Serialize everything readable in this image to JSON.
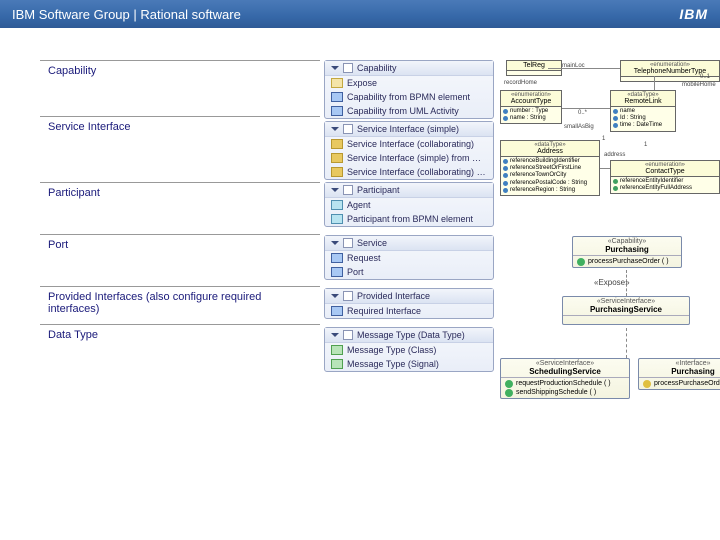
{
  "header": {
    "title": "IBM Software Group | Rational software",
    "logo_text": "IBM"
  },
  "sections": [
    {
      "title": "Capability"
    },
    {
      "title": "Service Interface"
    },
    {
      "title": "Participant"
    },
    {
      "title": "Port"
    },
    {
      "title": "Provided Interfaces (also configure required interfaces)"
    },
    {
      "title": "Data Type"
    }
  ],
  "menus": {
    "capability": {
      "header": "Capability",
      "items": [
        {
          "label": "Expose",
          "icon": "yellow"
        },
        {
          "label": "Capability from BPMN element",
          "icon": "blue"
        },
        {
          "label": "Capability from UML Activity",
          "icon": "blue"
        }
      ]
    },
    "serviceInterface": {
      "header": "Service Interface (simple)",
      "items": [
        {
          "label": "Service Interface (collaborating)",
          "icon": "gold"
        },
        {
          "label": "Service Interface (simple) from BPMN class",
          "icon": "gold"
        },
        {
          "label": "Service Interface (collaborating) from BPMN",
          "icon": "gold"
        }
      ]
    },
    "participant": {
      "header": "Participant",
      "items": [
        {
          "label": "Agent",
          "icon": "cyan"
        },
        {
          "label": "Participant from BPMN element",
          "icon": "cyan"
        }
      ]
    },
    "port": {
      "header": "Service",
      "items": [
        {
          "label": "Request",
          "icon": "blue"
        },
        {
          "label": "Port",
          "icon": "blue"
        }
      ]
    },
    "provided": {
      "header": "Provided Interface",
      "items": [
        {
          "label": "Required Interface",
          "icon": "blue"
        }
      ]
    },
    "dataType": {
      "header": "Message Type (Data Type)",
      "items": [
        {
          "label": "Message Type (Class)",
          "icon": "green"
        },
        {
          "label": "Message Type (Signal)",
          "icon": "green"
        }
      ]
    }
  },
  "uml_top": {
    "telReg": {
      "stereotype": "",
      "name": "TelReg",
      "body": []
    },
    "telType": {
      "stereotype": "«enumeration»",
      "name": "TelephoneNumberType",
      "body": []
    },
    "address": {
      "stereotype": "«dataType»",
      "name": "Address",
      "body": [
        "referenceBuildingIdentifier",
        "referenceStreetOrFirstLine",
        "referenceTownOrCity",
        "referencePostalCode : String",
        "referenceRegion : String"
      ]
    },
    "accountType": {
      "stereotype": "«enumeration»",
      "name": "AccountType",
      "body": [
        "number : Type",
        "name : String"
      ]
    },
    "remoteLink": {
      "stereotype": "«dataType»",
      "name": "RemoteLink",
      "body": [
        "name",
        "Id : String",
        "time : DateTime"
      ]
    },
    "contact": {
      "stereotype": "«enumeration»",
      "name": "ContactType",
      "body": [
        "referenceEntityIdentifier",
        "referenceEntityFullAddress"
      ]
    },
    "labels": {
      "main": "mainLoc",
      "record": "recordHome",
      "order": "smallAsBig",
      "mobile": "mobileHome",
      "sep": "1",
      "card1": "0..1",
      "card2": "0..*",
      "addr": "address"
    }
  },
  "uml_bottom": {
    "purchasing": {
      "stereotype": "«Capability»",
      "name": "Purchasing",
      "op": "processPurchaseOrder ( )"
    },
    "expose": "«Expose»",
    "purchasingService": {
      "stereotype": "«ServiceInterface»",
      "name": "PurchasingService"
    },
    "scheduling": {
      "stereotype": "«ServiceInterface»",
      "name": "SchedulingService",
      "ops": [
        "requestProductionSchedule ( )",
        "sendShippingSchedule ( )"
      ]
    },
    "iface": {
      "stereotype": "«Interface»",
      "name": "Purchasing",
      "op": "processPurchaseOrder ( )"
    }
  }
}
